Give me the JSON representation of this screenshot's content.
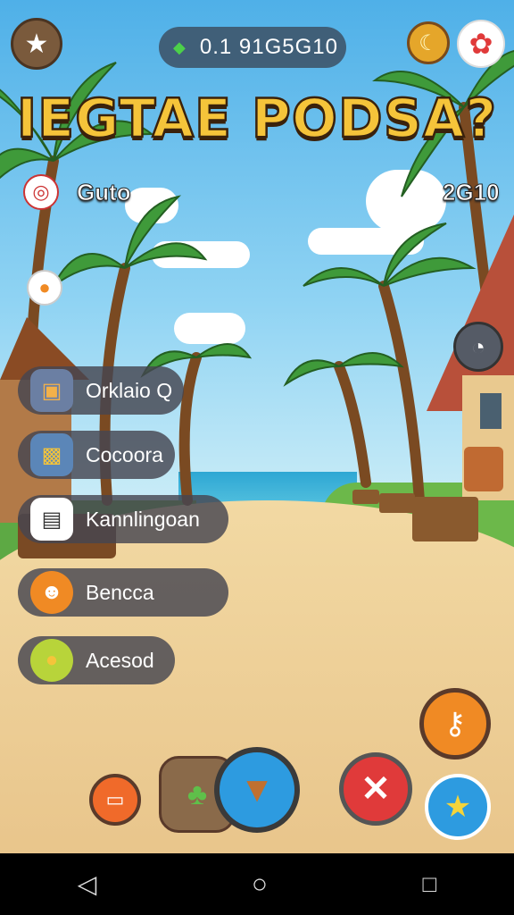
{
  "hud": {
    "currency_value": "0.1 91G5G10",
    "title": "IEGTAE PODSA?",
    "left_counter": "Guto",
    "right_counter": "2G10"
  },
  "menu": [
    {
      "label": "Orklaio Q",
      "icon": "chest-icon"
    },
    {
      "label": "Cocoora",
      "icon": "lock-icon"
    },
    {
      "label": "Kannlingoan",
      "icon": "scroll-icon"
    },
    {
      "label": "Bencca",
      "icon": "character-icon"
    },
    {
      "label": "Acesod",
      "icon": "fruit-icon"
    }
  ],
  "colors": {
    "accent_orange": "#f08a24",
    "accent_blue": "#2d9be0",
    "accent_red": "#e03a3a",
    "menu_bg": "#46464f"
  },
  "icons": [
    "star-icon",
    "leaf-icon",
    "banana-icon",
    "gear-icon",
    "target-icon",
    "fruit-icon",
    "clock-icon",
    "key-icon",
    "close-icon",
    "map-icon",
    "leaf-icon",
    "fox-icon",
    "star-icon"
  ]
}
